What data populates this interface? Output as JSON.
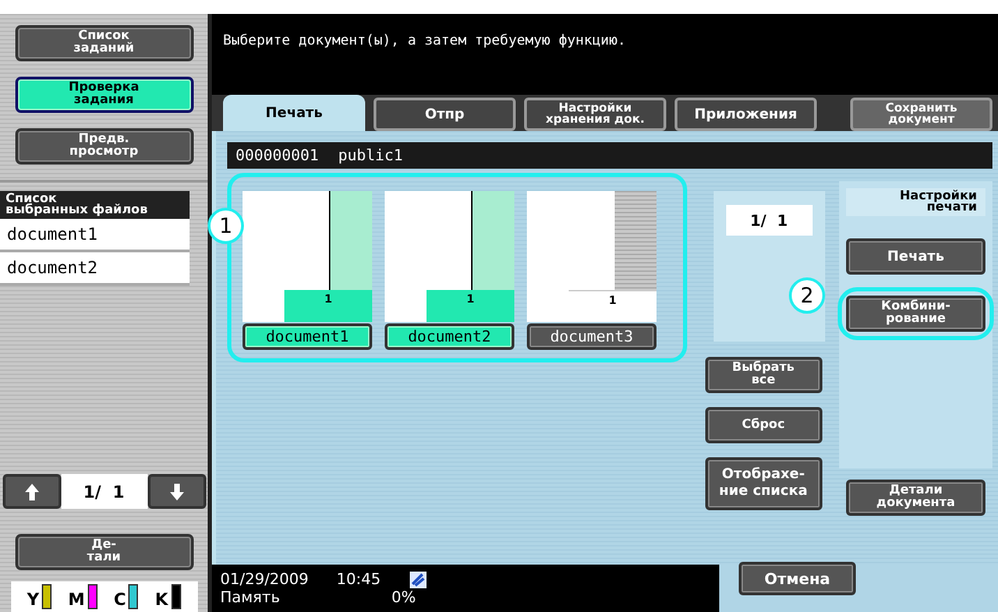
{
  "sidebar": {
    "buttons": [
      {
        "label": "Список\nзаданий",
        "selected": false
      },
      {
        "label": "Проверка\nзадания",
        "selected": true
      },
      {
        "label": "Предв.\nпросмотр",
        "selected": false
      }
    ],
    "file_list": {
      "title": "Список\nвыбранных файлов",
      "items": [
        "document1",
        "document2"
      ]
    },
    "pager": "1/  1",
    "details_button": "Де-\nтали",
    "toner": [
      {
        "label": "Y",
        "color": "#c8c000"
      },
      {
        "label": "M",
        "color": "#ff00ff"
      },
      {
        "label": "C",
        "color": "#30c8d0"
      },
      {
        "label": "K",
        "color": "#000000"
      }
    ]
  },
  "message": "Выберите документ(ы), а затем требуемую функцию.",
  "tabs": [
    {
      "label": "Печать",
      "selected": true
    },
    {
      "label": "Отпр",
      "selected": false
    },
    {
      "label": "Настройки\nхранения док.",
      "selected": false
    },
    {
      "label": "Приложения",
      "selected": false
    }
  ],
  "save_button": "Сохранить\nдокумент",
  "box_header": {
    "number": "000000001",
    "name": "public1"
  },
  "documents": [
    {
      "name": "document1",
      "count": "1",
      "selected": true
    },
    {
      "name": "document2",
      "count": "1",
      "selected": true
    },
    {
      "name": "document3",
      "count": "1",
      "selected": false
    }
  ],
  "page_counter": "1/  1",
  "callouts": [
    "1",
    "2"
  ],
  "list_buttons": [
    "Выбрать\nвсе",
    "Сброс",
    "Отобрахе-\nние списка"
  ],
  "print_settings": {
    "title": "Настройки\nпечати",
    "buttons": [
      {
        "label": "Печать",
        "highlighted": false
      },
      {
        "label": "Комбини-\nрование",
        "highlighted": true
      }
    ]
  },
  "document_details_button": "Детали\nдокумента",
  "status": {
    "date": "01/29/2009",
    "time": "10:45",
    "memory_label": "Память",
    "memory_value": "0%"
  },
  "cancel_button": "Отмена"
}
